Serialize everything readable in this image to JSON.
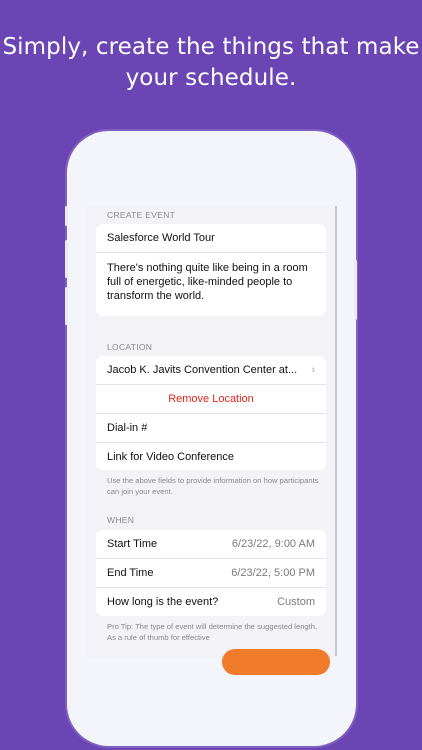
{
  "headline": {
    "line1": "Simply, create the things that make",
    "line2": "your schedule."
  },
  "create_event": {
    "section_label": "CREATE EVENT",
    "title_value": "Salesforce World Tour",
    "description_value": "There's nothing quite like being in a room full of energetic, like-minded people to transform the world."
  },
  "location": {
    "section_label": "LOCATION",
    "place_value": "Jacob K. Javits Convention Center at...",
    "remove_label": "Remove Location",
    "dial_in_placeholder": "Dial-in #",
    "video_link_placeholder": "Link for Video Conference",
    "note": "Use the above fields to provide information on how participants can join your event."
  },
  "when": {
    "section_label": "WHEN",
    "start_label": "Start Time",
    "start_value": "6/23/22, 9:00 AM",
    "end_label": "End Time",
    "end_value": "6/23/22, 5:00 PM",
    "duration_label": "How long is the event?",
    "duration_value": "Custom",
    "tip": "Pro Tip: The type of event will determine the suggested length. As a rule of thumb for effective"
  },
  "colors": {
    "background": "#6b45b4",
    "destructive": "#e0261b",
    "accent": "#f07b2a"
  }
}
